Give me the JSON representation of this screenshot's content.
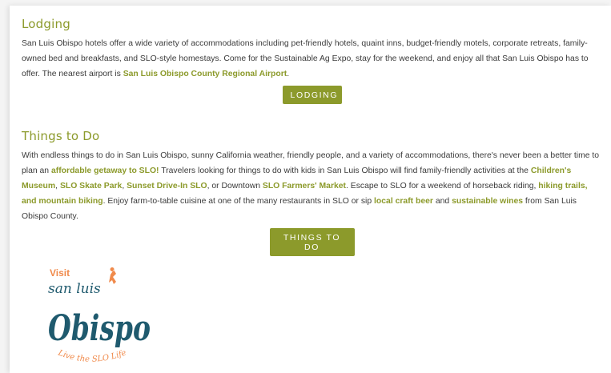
{
  "lodging": {
    "heading": "Lodging",
    "p1": "San Luis Obispo hotels offer a wide variety of accommodations including pet-friendly hotels, quaint inns, budget-friendly motels, corporate retreats, family-owned bed and breakfasts, and SLO-style homestays. Come for the Sustainable Ag Expo, stay for the weekend, and enjoy all that San Luis Obispo has to offer. The nearest airport is ",
    "airport_link": "San Luis Obispo County Regional Airport",
    "p1_end": ".",
    "button": "LODGING"
  },
  "things": {
    "heading": "Things to Do",
    "t1": "With endless things to do in San Luis Obispo, sunny California weather, friendly people, and a variety of accommodations, there's never been a better time to plan an ",
    "link_getaway": "affordable getaway to SLO!",
    "t2": " Travelers looking for things to do with kids in San Luis Obispo will find family-friendly activities at the ",
    "link_museum": "Children's Museum",
    "t3": ", ",
    "link_skate": "SLO Skate Park",
    "t4": ", ",
    "link_drivein": "Sunset Drive-In SLO",
    "t5": ", or Downtown ",
    "link_market": "SLO Farmers' Market",
    "t6": ". Escape to SLO for a weekend of horseback riding, ",
    "link_hiking": "hiking trails, and mountain biking",
    "t7": ". Enjoy farm-to-table cuisine at one of the many restaurants in SLO or sip ",
    "link_beer": "local craft beer",
    "t8": " and ",
    "link_wine": "sustainable wines",
    "t9": " from San Luis Obispo County.",
    "button": "THINGS TO DO"
  },
  "logo": {
    "visit": "Visit",
    "san_luis": "san luis",
    "obispo": "Obispo",
    "tagline": "Live the SLO Life"
  },
  "colors": {
    "accent": "#8c9a2b",
    "logo_orange": "#f08a4b",
    "logo_teal": "#1f5a6e"
  }
}
